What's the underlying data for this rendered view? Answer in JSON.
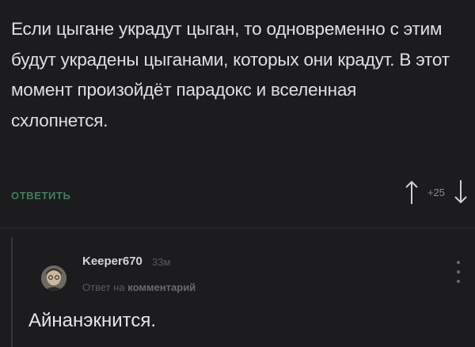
{
  "comment": {
    "text": "Если цыгане украдут цыган, то одновременно с этим будут украдены цыганами, которых они крадут. В этот момент произойдёт парадокс и вселенная схлопнется.",
    "reply_label": "ОТВЕТИТЬ",
    "rating": "+25"
  },
  "reply": {
    "author": "Keeper670",
    "time": "33м",
    "reply_prefix": "Ответ на",
    "reply_target": "комментарий",
    "text": "Айнанэкнится."
  },
  "icons": {
    "upvote": "arrow-up-icon",
    "downvote": "arrow-down-icon",
    "menu": "more-vertical-icon"
  },
  "colors": {
    "background": "#1c1c1e",
    "text": "#e0e0e0",
    "accent": "#3f7f5c",
    "muted": "#5a5a5a"
  }
}
